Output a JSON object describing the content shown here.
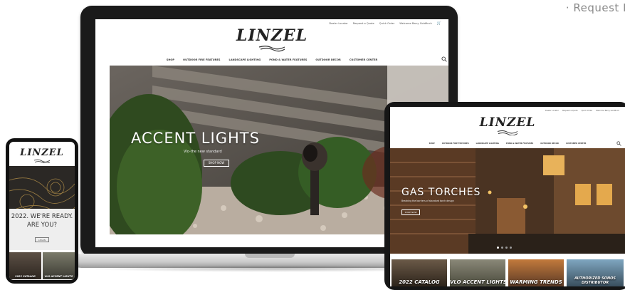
{
  "corner_text": "· Request R",
  "laptop": {
    "top_links": [
      "Dealer Locator",
      "Request a Quote",
      "Quick Order",
      "Welcome Barry Goldfinch"
    ],
    "cart_icon": "cart-icon",
    "logo": "LINZEL",
    "nav": [
      "SHOP",
      "OUTDOOR FIRE FEATURES",
      "LANDSCAPE LIGHTING",
      "POND & WATER FEATURES",
      "OUTDOOR DECOR",
      "CUSTOMER CENTER"
    ],
    "search_icon": "search-icon",
    "hero": {
      "title": "ACCENT LIGHTS",
      "subtitle": "Vlo-the new standard",
      "button": "SHOP NOW"
    }
  },
  "phone": {
    "logo": "LINZEL",
    "headline_line1": "2022. WE'RE READY.",
    "headline_line2": "ARE YOU?",
    "button": "LEARN",
    "tiles": [
      "2022 CATALOG",
      "VLO ACCENT LIGHTS"
    ]
  },
  "tablet": {
    "top_links": [
      "Dealer Locator",
      "Request a Quote",
      "Quick Order",
      "Welcome Barry Goldfinch"
    ],
    "logo": "LINZEL",
    "nav": [
      "SHOP",
      "OUTDOOR FIRE FEATURES",
      "LANDSCAPE LIGHTING",
      "POND & WATER FEATURES",
      "OUTDOOR DECOR",
      "CUSTOMER CENTER"
    ],
    "hero": {
      "title": "GAS TORCHES",
      "subtitle": "Breaking the barriers of standard torch design",
      "button": "SHOP NOW"
    },
    "tiles": [
      "2022 CATALOG",
      "VLO ACCENT LIGHTS",
      "WARMING TRENDS",
      "AUTHORIZED SONOS DISTRIBUTOR"
    ]
  },
  "colors": {
    "device_frame": "#161616",
    "accent_text": "#ffffff",
    "corner_text": "#8a8a8a"
  }
}
